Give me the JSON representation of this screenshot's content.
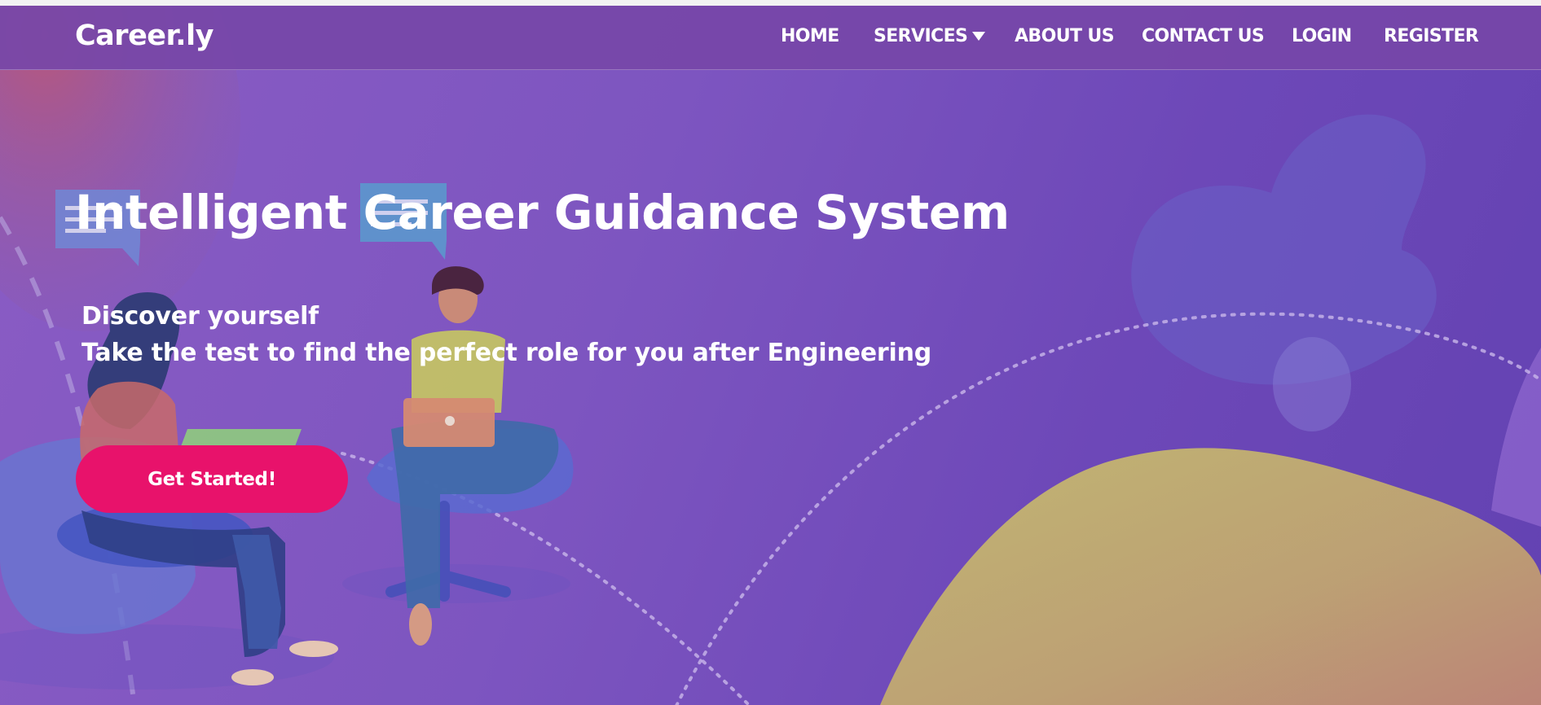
{
  "brand": {
    "name": "Career.ly"
  },
  "nav": {
    "items": [
      {
        "label": "HOME"
      },
      {
        "label": "SERVICES"
      },
      {
        "label": "ABOUT US"
      },
      {
        "label": "CONTACT US"
      },
      {
        "label": "LOGIN"
      },
      {
        "label": "REGISTER"
      }
    ]
  },
  "hero": {
    "title": "Intelligent Career Guidance System",
    "line1": "Discover yourself",
    "line2": "Take the test to find the perfect role for you after Engineering",
    "cta_label": "Get Started!"
  },
  "colors": {
    "nav_bg": "#7646a8",
    "hero_bg": "#7d55c0",
    "cta": "#e8126b",
    "blob_yellow": "#c9b86a"
  },
  "icons": [
    "chevron-down-icon",
    "chat-bubble-icon"
  ]
}
